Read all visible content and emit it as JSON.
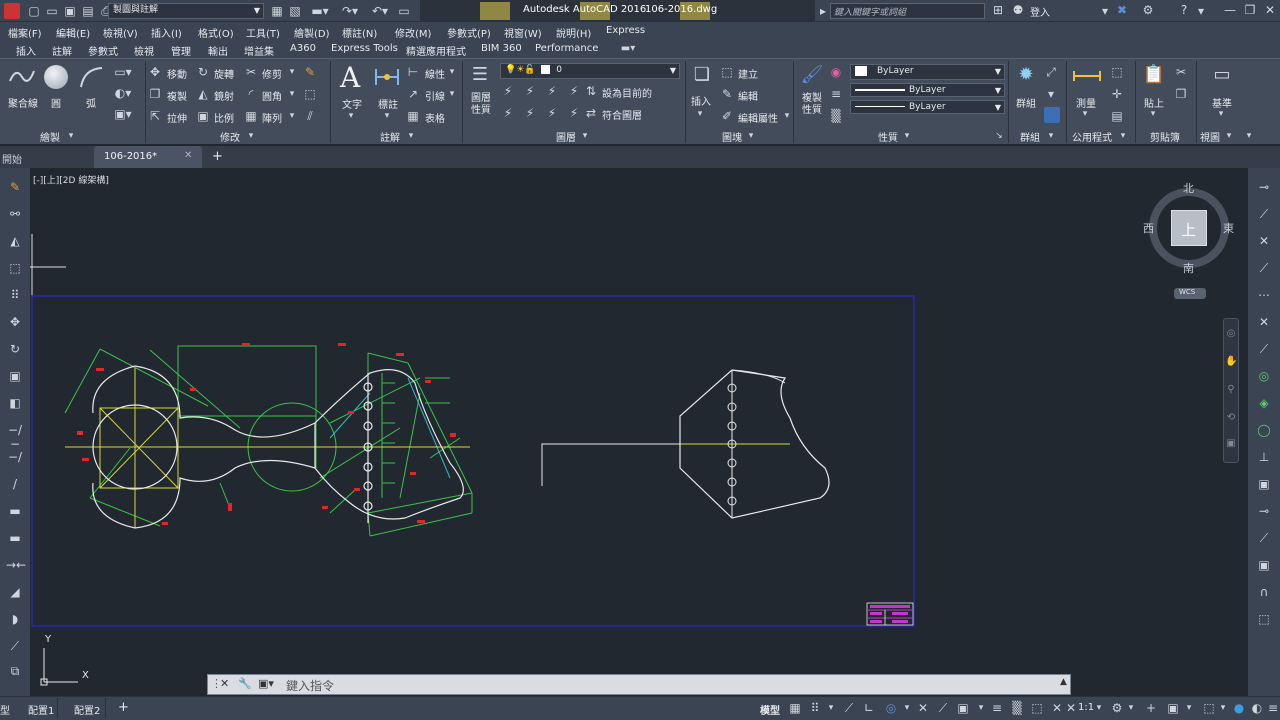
{
  "titlebar": {
    "workspace": "製圖與註解",
    "app_title": "Autodesk AutoCAD 2016",
    "file_name": "106-2016.dwg",
    "search_placeholder": "鍵入關鍵字或詞組",
    "signin": "登入"
  },
  "menubar": [
    "檔案(F)",
    "編輯(E)",
    "檢視(V)",
    "插入(I)",
    "格式(O)",
    "工具(T)",
    "繪製(D)",
    "標註(N)",
    "修改(M)",
    "參數式(P)",
    "視窗(W)",
    "說明(H)",
    "Express"
  ],
  "ribbon_tabs": [
    "插入",
    "註解",
    "參數式",
    "檢視",
    "管理",
    "輸出",
    "增益集",
    "A360",
    "Express Tools",
    "精選應用程式",
    "BIM 360",
    "Performance"
  ],
  "ribbon": {
    "draw": {
      "title": "繪製",
      "polyline": "聚合線",
      "circle": "圓",
      "arc": "弧"
    },
    "modify": {
      "title": "修改",
      "move": "移動",
      "rotate": "旋轉",
      "trim": "修剪",
      "copy": "複製",
      "mirror": "鏡射",
      "fillet": "圓角",
      "stretch": "拉伸",
      "scale": "比例",
      "array": "陣列"
    },
    "annotation": {
      "title": "註解",
      "text": "文字",
      "dimension": "標註",
      "linear": "線性",
      "leader": "引線",
      "table": "表格"
    },
    "layers": {
      "title": "圖層",
      "layer_props": "圖層\n性質",
      "current_layer": "0",
      "set_current": "設為目前的",
      "match_layer": "符合圖層"
    },
    "block": {
      "title": "圖塊",
      "insert": "插入",
      "create": "建立",
      "edit": "編輯",
      "edit_attr": "編輯屬性"
    },
    "properties": {
      "title": "性質",
      "match": "複製\n性質",
      "color": "ByLayer",
      "linetype": "ByLayer",
      "lineweight": "ByLayer"
    },
    "groups": {
      "title": "群組",
      "group": "群組"
    },
    "utilities": {
      "title": "公用程式",
      "measure": "測量"
    },
    "clipboard": {
      "title": "剪貼簿",
      "paste": "貼上"
    },
    "view": {
      "title": "視圖",
      "base": "基準"
    }
  },
  "doctabs": {
    "start": "開始",
    "drawing": "106-2016*"
  },
  "viewport": {
    "label": "[-][上][2D 線架構]",
    "viewcube": {
      "north": "北",
      "south": "南",
      "east": "東",
      "west": "西",
      "top": "上",
      "wcs": "WCS"
    },
    "ucs_y": "Y",
    "ucs_x": "X"
  },
  "command": {
    "placeholder": "鍵入指令"
  },
  "statusbar": {
    "model": "模型",
    "layout1": "配置1",
    "layout2": "配置2",
    "scale": "1:1",
    "model_tab": "型"
  },
  "colors": {
    "accent": "#3b4453",
    "canvas": "#212830",
    "green": "#3cc24a",
    "yellow": "#d8d83a",
    "red": "#e0262b",
    "white": "#e8e8e8",
    "blue": "#2828a8",
    "cyan": "#3ab8c8",
    "magenta": "#c038c8"
  }
}
